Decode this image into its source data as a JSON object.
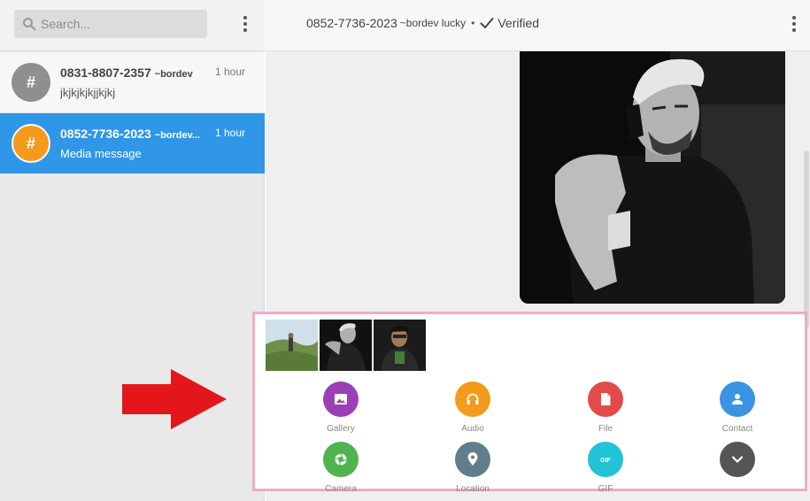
{
  "search": {
    "placeholder": "Search..."
  },
  "conversations": [
    {
      "number": "0831-8807-2357",
      "alias": "~bordev",
      "time": "1 hour",
      "preview": "jkjkjkjkjjkjkj",
      "avatar": "#"
    },
    {
      "number": "0852-7736-2023",
      "alias": "~bordev...",
      "time": "1 hour",
      "preview": "Media message",
      "avatar": "#"
    }
  ],
  "chat_header": {
    "number": "0852-7736-2023",
    "alias": "~bordev lucky",
    "separator": "•",
    "status": "Verified"
  },
  "attachments": {
    "thumbnails": [
      "thumbnail-landscape",
      "thumbnail-portrait-bw",
      "thumbnail-portrait-selfie"
    ],
    "actions": [
      {
        "label": "Gallery",
        "icon": "image-icon",
        "color": "#9c3fb6"
      },
      {
        "label": "Audio",
        "icon": "headphones-icon",
        "color": "#f29b1c"
      },
      {
        "label": "File",
        "icon": "file-icon",
        "color": "#e34b4b"
      },
      {
        "label": "Contact",
        "icon": "person-icon",
        "color": "#3a93e3"
      },
      {
        "label": "Camera",
        "icon": "camera-icon",
        "color": "#4fb34f"
      },
      {
        "label": "Location",
        "icon": "location-pin-icon",
        "color": "#607d8b"
      },
      {
        "label": "GIF",
        "icon": "gif-icon",
        "color": "#21c3d6"
      },
      {
        "label": "",
        "icon": "chevron-down-icon",
        "color": "#555555"
      }
    ]
  },
  "colors": {
    "selected_conversation": "#2f96e8",
    "annotation_arrow": "#e3161b",
    "annotation_border": "#f2aac4"
  }
}
